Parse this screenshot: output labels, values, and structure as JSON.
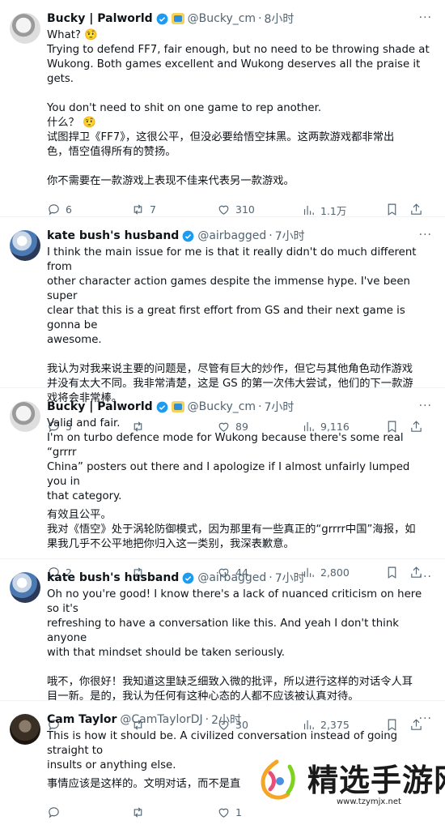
{
  "tweets": [
    {
      "name": "Bucky | Palworld",
      "handle": "@Bucky_cm",
      "time": "8小时",
      "lines": [
        "What? 🤨",
        "Trying to defend FF7, fair enough, but no need to be throwing shade at",
        "Wukong. Both games excellent and Wukong deserves all the praise it gets.",
        "",
        "You don't need to shit on one game to rep another.",
        "什么？ 🤨",
        "试图捍卫《FF7》，这很公平，但没必要给悟空抹黑。这两款游戏都非常出",
        "色，悟空值得所有的赞扬。",
        "",
        "你不需要在一款游戏上表现不佳来代表另一款游戏。"
      ],
      "replies": "6",
      "retweets": "7",
      "likes": "310",
      "views": "1.1万"
    },
    {
      "name": "kate bush's husband",
      "handle": "@airbagged",
      "time": "7小时",
      "lines": [
        "I think the main issue for me is that it really didn't do much different from",
        "other character action games despite the immense hype.  I've been super",
        "clear that this is a great first effort from GS and their next game is gonna be",
        "awesome.",
        "",
        "我认为对我来说主要的问题是，尽管有巨大的炒作，但它与其他角色动作游戏",
        "并没有太大不同。我非常清楚，这是 GS 的第一次伟大尝试，他们的下一款游",
        "戏将会非常棒。"
      ],
      "replies": "5",
      "retweets": "",
      "likes": "89",
      "views": "9,116"
    },
    {
      "name": "Bucky | Palworld",
      "handle": "@Bucky_cm",
      "time": "7小时",
      "lines": [
        "Valid and fair.",
        "I'm on turbo defence mode for Wukong because there's some real “grrrr",
        "China” posters out there and I apologize if I almost unfairly lumped you in",
        "that category.",
        "有效且公平。",
        "我对《悟空》处于涡轮防御模式，因为那里有一些真正的“grrrr中国”海报，如",
        "果我几乎不公平地把你归入这一类别，我深表歉意。"
      ],
      "replies": "2",
      "retweets": "",
      "likes": "44",
      "views": "2,800"
    },
    {
      "name": "kate bush's husband",
      "handle": "@airbagged",
      "time": "7小时",
      "lines": [
        "Oh no you're good! I know there's a lack of nuanced criticism on here so it's",
        "refreshing to have a conversation like this.  And yeah I don't think anyone",
        "with that mindset should be taken seriously.",
        "",
        "哦不，你很好！我知道这里缺乏细致入微的批评，所以进行这样的对话令人耳",
        "目一新。是的，我认为任何有这种心态的人都不应该被认真对待。"
      ],
      "replies": "",
      "retweets": "",
      "likes": "30",
      "views": "2,375"
    },
    {
      "name": "Cam Taylor",
      "handle": "@CamTaylorDJ",
      "time": "2小时",
      "lines": [
        "This is how it should be. A civilized conversation instead of going straight to",
        "insults or anything else.",
        "事情应该是这样的。文明对话，而不是直"
      ],
      "replies": "",
      "retweets": "",
      "likes": "1",
      "views": ""
    }
  ],
  "watermark": {
    "text": "精选手游网",
    "url": "www.tzymjx.net"
  },
  "colors": {
    "verified": "#1d9bf0",
    "muted": "#536471",
    "text": "#0f1419"
  }
}
